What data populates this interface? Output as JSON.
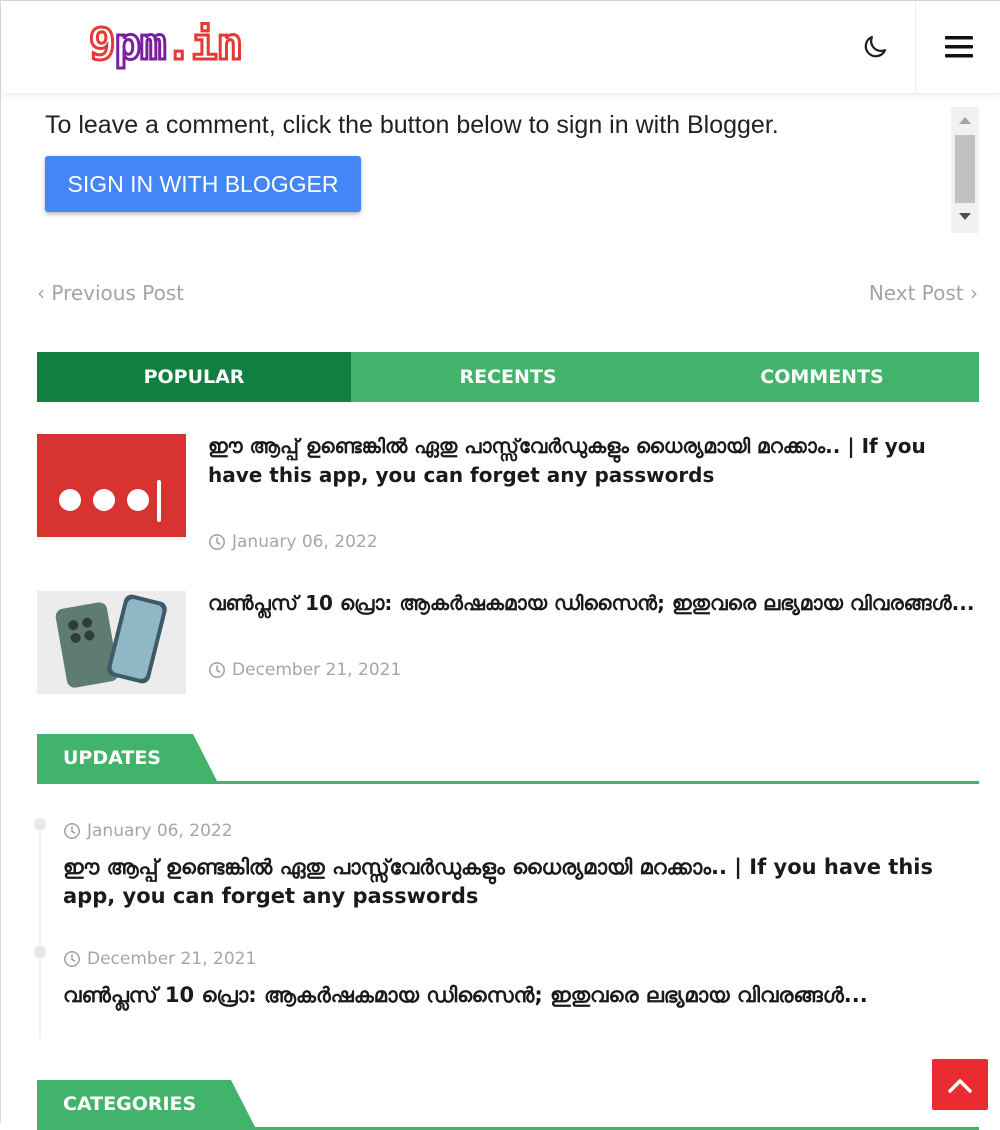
{
  "header": {
    "logo_part1": "9",
    "logo_part2": "pm",
    "logo_part3": ".in",
    "theme_toggle_icon": "moon-icon",
    "menu_icon": "hamburger-menu-icon"
  },
  "comments": {
    "prompt": "To leave a comment, click the button below to sign in with Blogger.",
    "signin_label": "SIGN IN WITH BLOGGER"
  },
  "post_nav": {
    "previous": "Previous Post",
    "next": "Next Post"
  },
  "tabs": [
    {
      "label": "POPULAR",
      "active": true
    },
    {
      "label": "RECENTS",
      "active": false
    },
    {
      "label": "COMMENTS",
      "active": false
    }
  ],
  "popular_posts": [
    {
      "title": "ഈ ആപ്പ് ഉണ്ടെങ്കിൽ ഏതു പാസ്സ്‌വേർഡുകളും ധൈര്യമായി മറക്കാം.. | If you have this app, you can forget any passwords",
      "date": "January 06, 2022"
    },
    {
      "title": "വൺപ്ലസ് 10 പ്രൊ: ആകർഷകമായ ഡിസൈൻ; ഇതുവരെ ലഭ്യമായ വിവരങ്ങൾ...",
      "date": "December 21, 2021"
    }
  ],
  "updates": {
    "heading": "UPDATES",
    "items": [
      {
        "date": "January 06, 2022",
        "title": "ഈ ആപ്പ് ഉണ്ടെങ്കിൽ ഏതു പാസ്സ്‌വേർഡുകളും ധൈര്യമായി മറക്കാം.. | If you have this app, you can forget any passwords"
      },
      {
        "date": "December 21, 2021",
        "title": "വൺപ്ലസ് 10 പ്രൊ: ആകർഷകമായ ഡിസൈൻ; ഇതുവരെ ലഭ്യമായ വിവരങ്ങൾ..."
      }
    ]
  },
  "categories": {
    "heading": "CATEGORIES"
  },
  "colors": {
    "accent_green": "#41b36a",
    "active_tab_green": "#0f8040",
    "signin_blue": "#4287f5",
    "back_to_top_red": "#ea2b32"
  }
}
